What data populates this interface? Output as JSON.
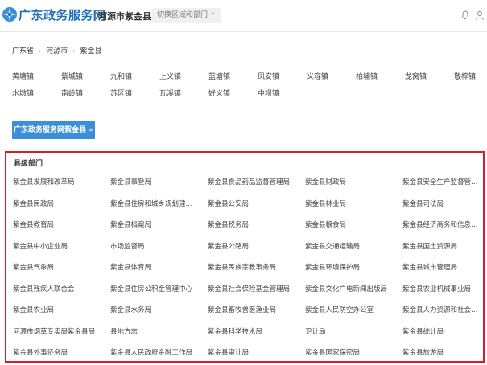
{
  "header": {
    "brand": "广东政务服务网",
    "region": "河源市紫金县",
    "switch_label": "切换区域和部门",
    "switch_caret": "^"
  },
  "breadcrumb": [
    "广东省",
    "河源市",
    "紫金县"
  ],
  "towns": [
    "黄塘镇",
    "紫城镇",
    "九和镇",
    "上义镇",
    "蓝塘镇",
    "凤安镇",
    "义容镇",
    "柏埔镇",
    "龙窝镇",
    "敬梓镇",
    "水墩镇",
    "南岭镇",
    "苏区镇",
    "瓦溪镇",
    "好义镇",
    "中坝镇"
  ],
  "province_button": "广东政务服务网紫金县 »",
  "departments": {
    "title": "县级部门",
    "items": [
      "紫金县发展和改革局",
      "紫金县事登局",
      "紫金县食品药品监督管理局",
      "紫金县财政局",
      "紫金县安全生产监督管理局",
      "紫金县民政局",
      "紫金县住房和城乡规划建...",
      "紫金县公安局",
      "紫金县林业局",
      "紫金县司法局",
      "紫金县教育局",
      "紫金县档案局",
      "紫金县税务局",
      "紫金县粮食局",
      "紫金县经济商务和信息化局",
      "紫金县中小企业局",
      "市场监督局",
      "紫金县公路局",
      "紫金县交通运输局",
      "紫金县国土资源局",
      "紫金县气象局",
      "紫金县体育局",
      "紫金县民族宗教事务局",
      "紫金县环境保护局",
      "紫金县城市管理局",
      "紫金县残疾人联合会",
      "紫金县住房公积金管理中心",
      "紫金县社会保险基金管理局",
      "紫金县文化广电新闻出版局",
      "紫金县农业机械事业局",
      "紫金县农业局",
      "紫金县水务局",
      "紫金县畜牧兽医渔业局",
      "紫金县人民防空办公室",
      "紫金县人力资源和社会保...",
      "河源市烟草专卖局紫金县局",
      "县地方志",
      "紫金县科学技术局",
      "卫计局",
      "紫金县统计局",
      "紫金县外事侨务局",
      "紫金县人民政府金融工作局",
      "紫金县审计局",
      "紫金县国家保密局",
      "紫金县旅游局"
    ]
  },
  "colors": {
    "brand_blue": "#1f6fb5",
    "button_blue": "#3b8fd8",
    "highlight_red": "#d91d26"
  },
  "icons": [
    "logo-icon",
    "bell-icon",
    "user-icon"
  ]
}
